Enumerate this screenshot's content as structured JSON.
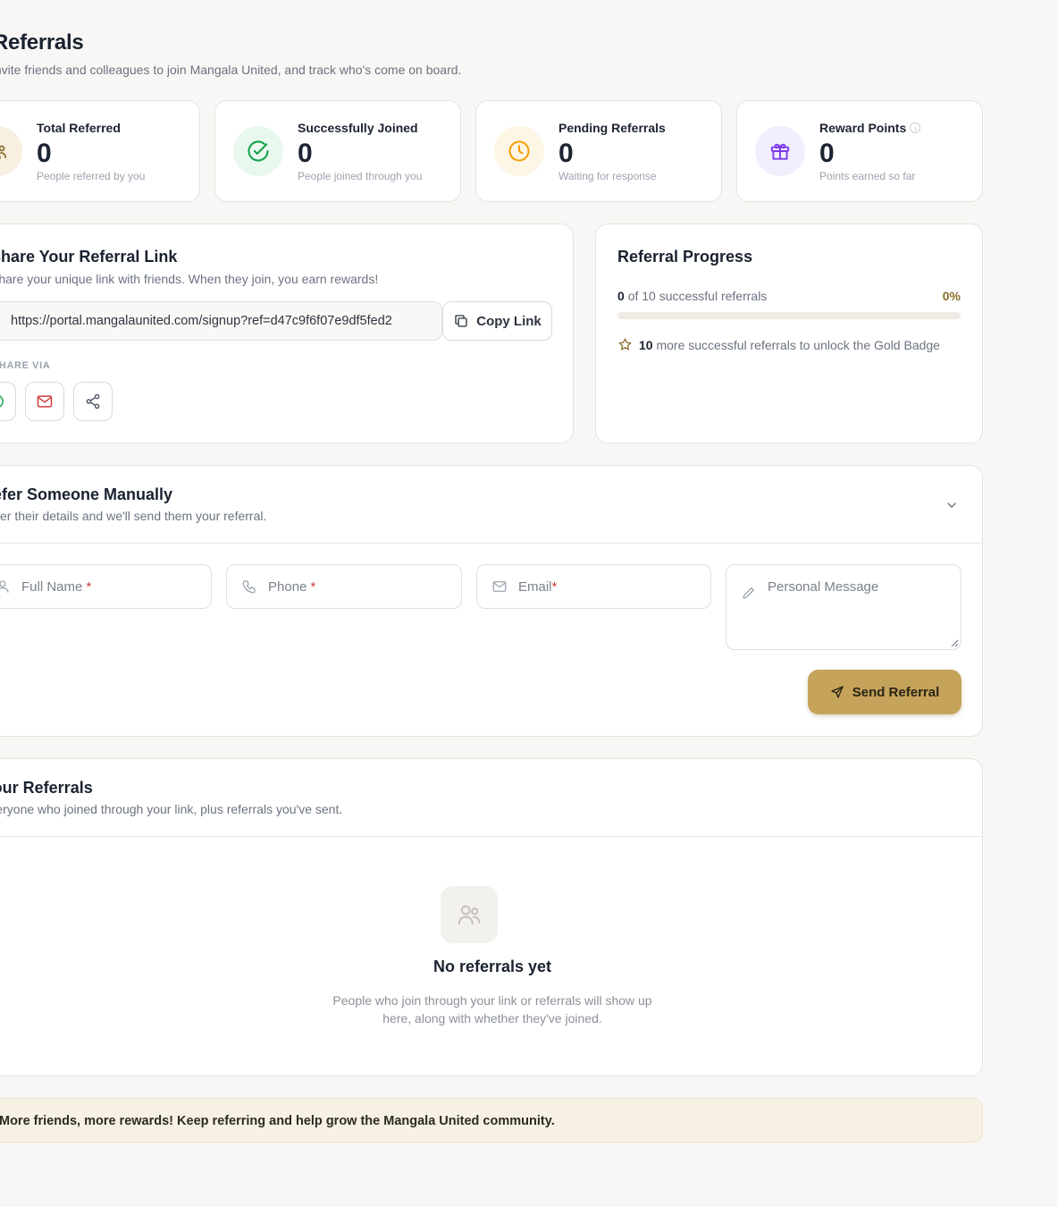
{
  "header": {
    "title": "Referrals",
    "subtitle": "Invite friends and colleagues to join Mangala United, and track who's come on board."
  },
  "stats": [
    {
      "label": "Total Referred",
      "value": "0",
      "caption": "People referred by you",
      "icon": "users-icon",
      "color": "#8a6f2c",
      "bg": "#f7efe0"
    },
    {
      "label": "Successfully Joined",
      "value": "0",
      "caption": "People joined through you",
      "icon": "check-circle-icon",
      "color": "#16a34a",
      "bg": "#e9f8ef"
    },
    {
      "label": "Pending Referrals",
      "value": "0",
      "caption": "Waiting for response",
      "icon": "clock-icon",
      "color": "#f59e0b",
      "bg": "#fef6e4"
    },
    {
      "label": "Reward Points",
      "value": "0",
      "caption": "Points earned so far",
      "icon": "gift-icon",
      "color": "#7c3aed",
      "bg": "#f3eefe"
    }
  ],
  "share": {
    "title": "Share Your Referral Link",
    "subtitle": "Share your unique link with friends. When they join, you earn rewards!",
    "link": "https://portal.mangalaunited.com/signup?ref=d47c9f6f07e9df5fed2",
    "copy_label": "Copy Link",
    "share_via_label": "SHARE VIA",
    "share_channels": [
      "whatsapp-icon",
      "email-icon",
      "share-icon"
    ]
  },
  "progress": {
    "title": "Referral Progress",
    "current": "0",
    "of_text": "of 10 successful referrals",
    "percent_label": "0%",
    "fraction": 0,
    "remaining": "10",
    "remaining_text": "more successful referrals to unlock the Gold Badge"
  },
  "manual": {
    "title": "Refer Someone Manually",
    "subtitle": "Enter their details and we'll send them your referral.",
    "full_name_placeholder": "Full Name",
    "phone_placeholder": "Phone",
    "email_placeholder": "Email",
    "required_mark": "*",
    "message_placeholder": "Personal Message",
    "send_label": "Send Referral"
  },
  "your_referrals": {
    "title": "Your Referrals",
    "subtitle": "Everyone who joined through your link, plus referrals you've sent.",
    "empty_title": "No referrals yet",
    "empty_text_1": "People who join through your link or referrals will show up",
    "empty_text_2": "here, along with whether they've joined."
  },
  "banner": {
    "text": "More friends, more rewards! Keep referring and help grow the Mangala United community."
  },
  "colors": {
    "accent": "#c6a35a",
    "page_bg": "#f8f7f5",
    "required": "#d03b3b"
  }
}
